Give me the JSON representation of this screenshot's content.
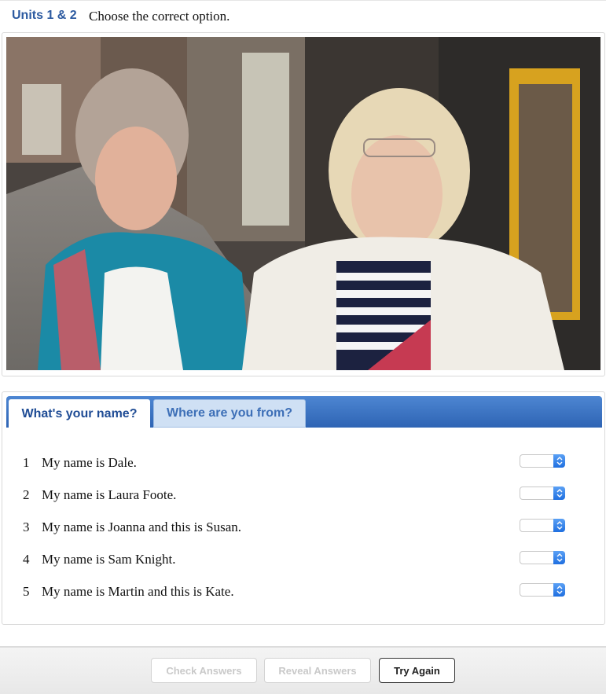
{
  "header": {
    "unit": "Units 1 & 2",
    "instruction": "Choose the correct option."
  },
  "tabs": [
    {
      "label": "What's your name?",
      "active": true
    },
    {
      "label": "Where are you from?",
      "active": false
    }
  ],
  "questions": [
    {
      "number": "1",
      "text": "My name is Dale.",
      "selected": ""
    },
    {
      "number": "2",
      "text": "My name is Laura Foote.",
      "selected": ""
    },
    {
      "number": "3",
      "text": "My name is Joanna and this is Susan.",
      "selected": ""
    },
    {
      "number": "4",
      "text": "My name is Sam Knight.",
      "selected": ""
    },
    {
      "number": "5",
      "text": "My name is Martin and this is Kate.",
      "selected": ""
    }
  ],
  "buttons": {
    "check": "Check Answers",
    "reveal": "Reveal Answers",
    "try_again": "Try Again"
  },
  "photo": {
    "alt": "Two women standing on a city street"
  },
  "colors": {
    "accent": "#2c5aa0",
    "tab_bar": "#3a72c2",
    "select_arrow": "#2f7ce8"
  }
}
